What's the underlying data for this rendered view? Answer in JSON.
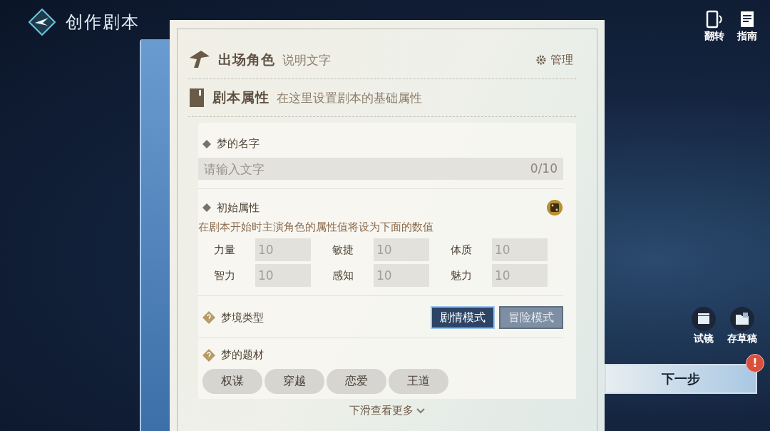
{
  "header": {
    "title": "创作剧本"
  },
  "top_actions": [
    {
      "kind": "flip",
      "label": "翻转"
    },
    {
      "kind": "guide",
      "label": "指南"
    }
  ],
  "panel": {
    "cast": {
      "title": "出场角色",
      "note": "说明文字",
      "manage": "管理"
    },
    "props": {
      "title": "剧本属性",
      "note": "在这里设置剧本的基础属性"
    },
    "dream_name": {
      "label": "梦的名字",
      "placeholder": "请输入文字",
      "counter": "0/10"
    },
    "initial_attrs": {
      "label": "初始属性",
      "description": "在剧本开始时主演角色的属性值将设为下面的数值",
      "attrs": [
        {
          "name": "力量",
          "value": "10"
        },
        {
          "name": "敏捷",
          "value": "10"
        },
        {
          "name": "体质",
          "value": "10"
        },
        {
          "name": "智力",
          "value": "10"
        },
        {
          "name": "感知",
          "value": "10"
        },
        {
          "name": "魅力",
          "value": "10"
        }
      ]
    },
    "dream_type": {
      "label": "梦境类型",
      "modes": [
        {
          "label": "剧情模式",
          "selected": true
        },
        {
          "label": "冒险模式",
          "selected": false
        }
      ]
    },
    "dream_theme": {
      "label": "梦的题材",
      "tags": [
        "权谋",
        "穿越",
        "恋爱",
        "王道"
      ]
    },
    "scroll_hint": "下滑查看更多"
  },
  "side_actions": [
    {
      "kind": "audition",
      "label": "试镜"
    },
    {
      "kind": "draft",
      "label": "存草稿"
    }
  ],
  "next_button": {
    "label": "下一步",
    "alert": "!"
  }
}
